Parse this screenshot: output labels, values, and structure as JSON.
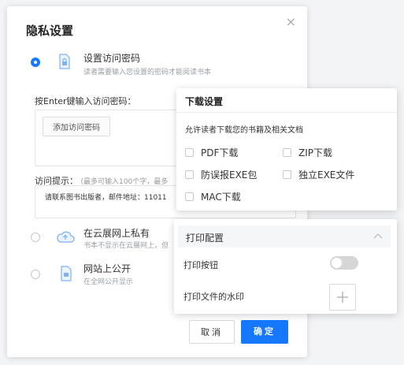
{
  "dialog": {
    "title": "隐私设置",
    "close_symbol": "×",
    "options": [
      {
        "title": "设置访问密码",
        "desc": "读者需要输入您设置的密码才能阅读书本",
        "icon": "lock-page-icon",
        "selected": true
      },
      {
        "title": "在云展网上私有",
        "desc": "书本不显示在云展网上，但",
        "icon": "cloud-icon",
        "selected": false
      },
      {
        "title": "网站上公开",
        "desc": "在全网公开显示",
        "icon": "public-page-icon",
        "selected": false
      }
    ],
    "password": {
      "label": "按Enter键输入访问密码：",
      "add_button": "添加访问密码"
    },
    "hint": {
      "label": "访问提示：",
      "sublabel": "(最多可输入100个字，最多",
      "text": "请联系图书出版者，邮件地址：11011"
    },
    "buttons": {
      "cancel": "取消",
      "ok": "确定"
    },
    "accent_color": "#1677ff"
  },
  "download": {
    "title": "下载设置",
    "desc": "允许读者下载您的书籍及相关文档",
    "options": [
      {
        "label": "PDF下载",
        "checked": false
      },
      {
        "label": "ZIP下载",
        "checked": false
      },
      {
        "label": "防误报EXE包",
        "checked": false
      },
      {
        "label": "独立EXE文件",
        "checked": false
      },
      {
        "label": "MAC下载",
        "checked": false
      }
    ]
  },
  "print": {
    "title": "打印配置",
    "print_button_label": "打印按钮",
    "print_button_on": false,
    "watermark_label": "打印文件的水印"
  }
}
